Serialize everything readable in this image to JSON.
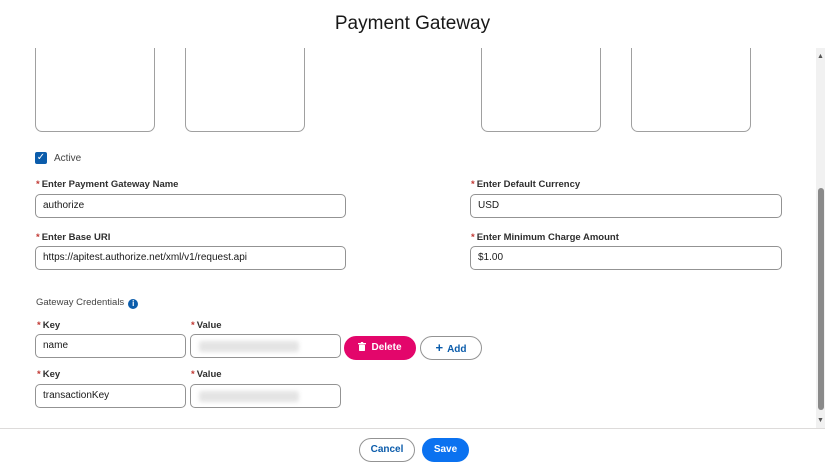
{
  "modal": {
    "title": "Payment Gateway"
  },
  "form": {
    "active_label": "Active",
    "active_checked": true,
    "gateway_name": {
      "label": "Enter Payment Gateway Name",
      "value": "authorize"
    },
    "default_currency": {
      "label": "Enter Default Currency",
      "value": "USD"
    },
    "base_uri": {
      "label": "Enter Base URI",
      "value": "https://apitest.authorize.net/xml/v1/request.api"
    },
    "min_charge": {
      "label": "Enter Minimum Charge Amount",
      "value": "$1.00"
    },
    "required_marker": "*"
  },
  "credentials": {
    "title": "Gateway Credentials",
    "info_icon": "i",
    "key_label": "Key",
    "value_label": "Value",
    "rows": [
      {
        "key": "name"
      },
      {
        "key": "transactionKey"
      }
    ],
    "delete_label": "Delete",
    "add_label": "Add",
    "add_glyph": "+"
  },
  "footer": {
    "cancel_label": "Cancel",
    "save_label": "Save"
  },
  "colors": {
    "brand": "#0b5cab",
    "delete": "#e3066b",
    "save": "#0b72f0",
    "required": "#c23934"
  }
}
